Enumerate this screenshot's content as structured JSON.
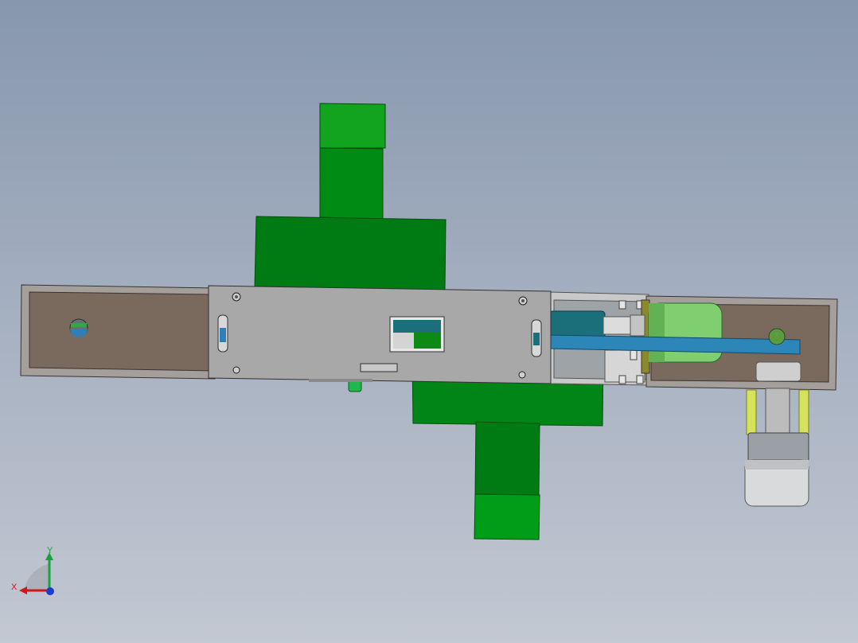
{
  "colors": {
    "background_top": "#8797ad",
    "background_bottom": "#c3c8d2",
    "green_part": "#007a12",
    "plate": "#a8a8a8",
    "brown_frame": "#7a6a5e",
    "teal_cylinder": "#1a6f7a",
    "blue_bar": "#2d86b8",
    "light_green_motor": "#7fcf70",
    "yellow_rod": "#d6e25a",
    "x_axis": "#d4141c",
    "y_axis": "#1aa13a",
    "z_axis": "#1e3bd1"
  },
  "triad": {
    "x_label": "X",
    "y_label": "Y"
  },
  "icons": {
    "triad": "coordinate-triad-icon"
  }
}
